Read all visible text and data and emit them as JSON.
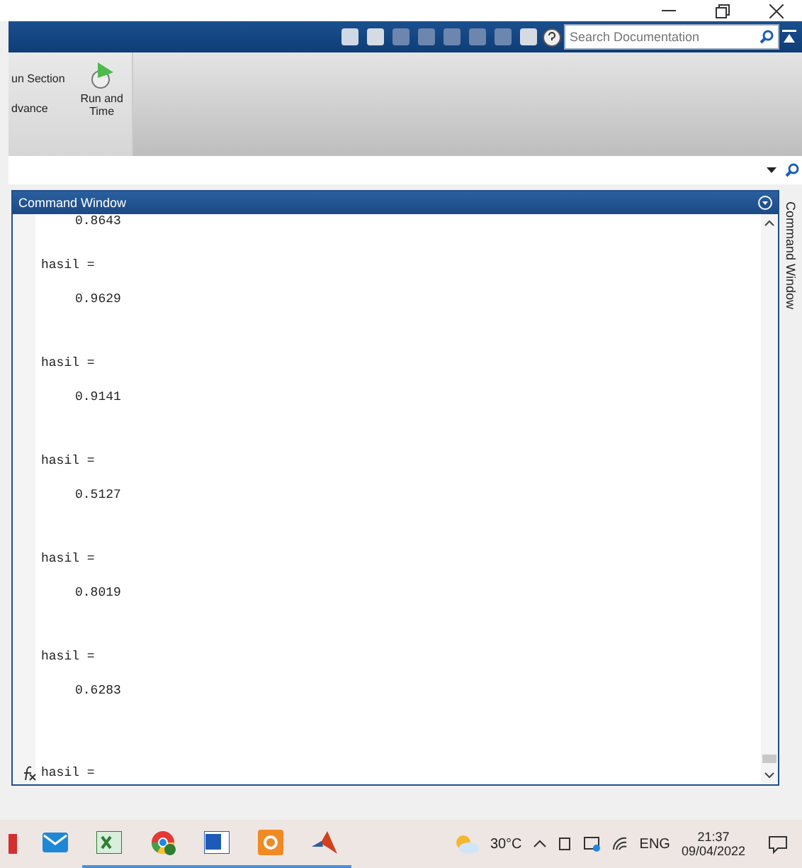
{
  "search": {
    "placeholder": "Search Documentation"
  },
  "ribbon": {
    "items": [
      {
        "label": "un Section"
      },
      {
        "label": "dvance"
      },
      {
        "label": "Run and Time"
      }
    ]
  },
  "command_window": {
    "title": "Command Window",
    "lines": [
      {
        "kind": "value",
        "text": "0.8643"
      },
      {
        "kind": "label",
        "text": "hasil ="
      },
      {
        "kind": "value",
        "text": "0.9629"
      },
      {
        "kind": "label",
        "text": "hasil ="
      },
      {
        "kind": "value",
        "text": "0.9141"
      },
      {
        "kind": "label",
        "text": "hasil ="
      },
      {
        "kind": "value",
        "text": "0.5127"
      },
      {
        "kind": "label",
        "text": "hasil ="
      },
      {
        "kind": "value",
        "text": "0.8019"
      },
      {
        "kind": "label",
        "text": "hasil ="
      },
      {
        "kind": "value",
        "text": "0.6283"
      }
    ],
    "prompt": "hasil ="
  },
  "side_tab": {
    "label": "Command Window"
  },
  "taskbar": {
    "apps": [
      {
        "kind": "mail",
        "running": false
      },
      {
        "kind": "sheet",
        "running": true
      },
      {
        "kind": "browser",
        "running": true
      },
      {
        "kind": "doc",
        "running": true
      },
      {
        "kind": "pdf",
        "running": true
      },
      {
        "kind": "peak",
        "running": true
      }
    ],
    "temperature": "30°C",
    "language": "ENG",
    "time": "21:37",
    "date": "09/04/2022"
  }
}
